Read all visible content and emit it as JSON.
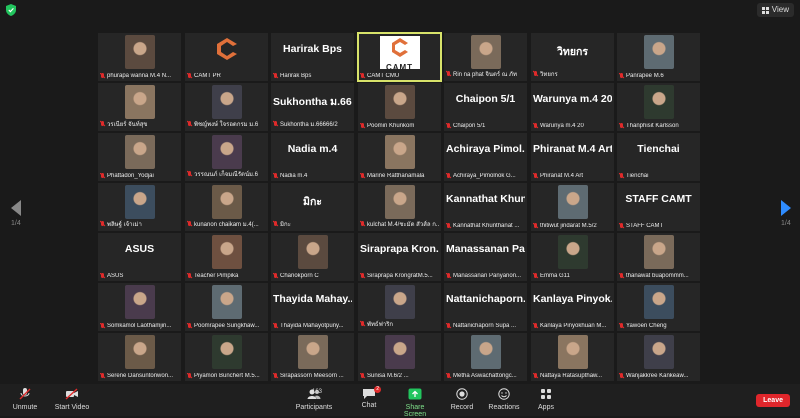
{
  "top": {
    "view_label": "View"
  },
  "nav": {
    "left_page": "1/4",
    "right_page": "1/4"
  },
  "tiles": [
    {
      "name": "phurapa wanna M.4 N...",
      "big": ""
    },
    {
      "name": "CAMT PR",
      "big": ""
    },
    {
      "name": "Harirak Bps",
      "big": "Harirak Bps"
    },
    {
      "name": "CAMT CMU",
      "big": ""
    },
    {
      "name": "Rin na phat จินตร์ ณ ภัท",
      "big": ""
    },
    {
      "name": "วิทยกร",
      "big": "วิทยกร"
    },
    {
      "name": "Panrapee M.6",
      "big": ""
    },
    {
      "name": "วรเนียร์ จันท์สุข",
      "big": ""
    },
    {
      "name": "พิชญ์พงษ์ ใจรอดกรม ม.6",
      "big": ""
    },
    {
      "name": "Sukhontha ม.66666/2",
      "big": "Sukhontha ม.666..."
    },
    {
      "name": "Poomin Khunkom",
      "big": ""
    },
    {
      "name": "Chaipon 5/1",
      "big": "Chaipon 5/1"
    },
    {
      "name": "Warunya m.4 20",
      "big": "Warunya m.4 20"
    },
    {
      "name": "Thanphisit Karlsson",
      "big": ""
    },
    {
      "name": "Phattadon_Yodjai",
      "big": ""
    },
    {
      "name": "วรรณนภ์ เก็จมณีรัตน์ม.6",
      "big": ""
    },
    {
      "name": "Nadia m.4",
      "big": "Nadia m.4"
    },
    {
      "name": "Marine Ratthanamala",
      "big": ""
    },
    {
      "name": "Achiraya_Pimolnok G...",
      "big": "Achiraya Pimol..."
    },
    {
      "name": "Phiranat M.4 Art",
      "big": "Phiranat M.4 Art"
    },
    {
      "name": "Tienchai",
      "big": "Tienchai"
    },
    {
      "name": "พลิษฐ์ เจ้าเม่า",
      "big": ""
    },
    {
      "name": "kunanon chaikam ม.4(...",
      "big": ""
    },
    {
      "name": "มิกะ",
      "big": "มิกะ"
    },
    {
      "name": "kulchat M.4/ชะมัด สัวส์ล ก...",
      "big": ""
    },
    {
      "name": "Kannathat Khunthanat ...",
      "big": "Kannathat Khun..."
    },
    {
      "name": "thitiwut jindarat M.5/2",
      "big": ""
    },
    {
      "name": "STAFF CAMT",
      "big": "STAFF CAMT"
    },
    {
      "name": "ASUS",
      "big": "ASUS"
    },
    {
      "name": "Teacher Pimpika",
      "big": ""
    },
    {
      "name": "Chanokporn C",
      "big": ""
    },
    {
      "name": "Siraprapa KrongratM.5...",
      "big": "Siraprapa Kron..."
    },
    {
      "name": "Manassanan Panyanon...",
      "big": "Manassanan Pa..."
    },
    {
      "name": "Emma G11",
      "big": ""
    },
    {
      "name": "thanawat buapommm...",
      "big": ""
    },
    {
      "name": "Somkamol Laothamjin...",
      "big": ""
    },
    {
      "name": "Poomrapee Sungkhaw...",
      "big": ""
    },
    {
      "name": "Thayida Mahayotpuny...",
      "big": "Thayida Mahay..."
    },
    {
      "name": "พัทธ์ฟาริก",
      "big": ""
    },
    {
      "name": "Nattanichaporn Supa ...",
      "big": "Nattanichaporn..."
    },
    {
      "name": "Kanlaya Pinyokhuan M...",
      "big": "Kanlaya Pinyok..."
    },
    {
      "name": "Yawoen Cheng",
      "big": ""
    },
    {
      "name": "Serene Dansuntonwon...",
      "big": ""
    },
    {
      "name": "Piyamon Bunchert M.5...",
      "big": ""
    },
    {
      "name": "Sirapassorn Meesorn ...",
      "big": ""
    },
    {
      "name": "Sunisa M.6/2 ...",
      "big": ""
    },
    {
      "name": "Metha Aswachattongc...",
      "big": ""
    },
    {
      "name": "Nattaya Ratasupthaw...",
      "big": ""
    },
    {
      "name": "Wanjakkree Kankeaw...",
      "big": ""
    }
  ],
  "camt_text": "CAMT",
  "toolbar": {
    "unmute": "Unmute",
    "start_video": "Start Video",
    "participants": "Participants",
    "participants_count": "163",
    "chat": "Chat",
    "chat_badge": "2",
    "share_screen": "Share Screen",
    "record": "Record",
    "reactions": "Reactions",
    "apps": "Apps",
    "leave": "Leave"
  },
  "colors": {
    "accent_green": "#22c55e",
    "leave_red": "#e0262b",
    "active_speaker": "#d8e36a"
  }
}
